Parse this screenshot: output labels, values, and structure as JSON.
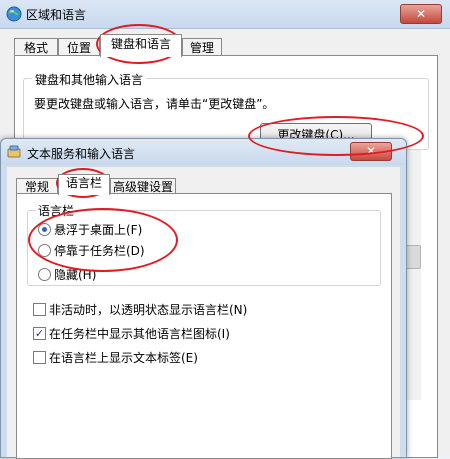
{
  "bg_window": {
    "title": "区域和语言",
    "close_glyph": "✕",
    "tabs": [
      "格式",
      "位置",
      "键盘和语言",
      "管理"
    ],
    "group_title": "键盘和其他输入语言",
    "hint": "要更改键盘或输入语言，请单击“更改键盘”。",
    "change_button": "更改键盘(C)..."
  },
  "dialog": {
    "title": "文本服务和输入语言",
    "close_glyph": "✕",
    "tabs": [
      "常规",
      "语言栏",
      "高级键设置"
    ],
    "group_title": "语言栏",
    "radios": [
      {
        "label": "悬浮于桌面上(F)",
        "checked": true
      },
      {
        "label": "停靠于任务栏(D)",
        "checked": false
      },
      {
        "label": "隐藏(H)",
        "checked": false
      }
    ],
    "checks": [
      {
        "label": "非活动时，以透明状态显示语言栏(N)",
        "checked": false,
        "mark": ""
      },
      {
        "label": "在任务栏中显示其他语言栏图标(I)",
        "checked": true,
        "mark": "✓"
      },
      {
        "label": "在语言栏上显示文本标签(E)",
        "checked": false,
        "mark": ""
      }
    ]
  },
  "colors": {
    "annotation": "#e01b22",
    "accent": "#2f63c3"
  }
}
